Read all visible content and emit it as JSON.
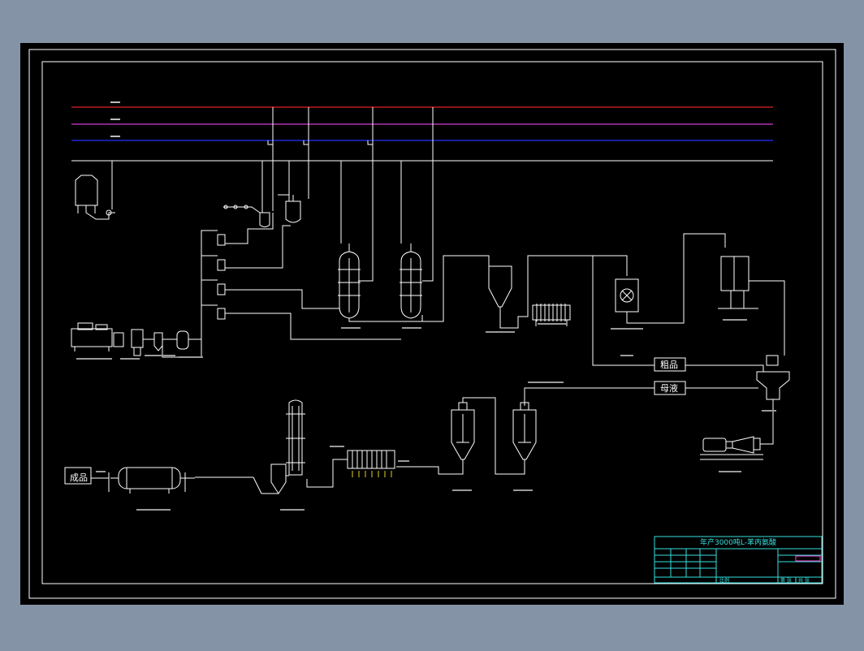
{
  "colors": {
    "app_background": "#8593a6",
    "drawing_background": "#000000",
    "line": "#ffffff",
    "utility_red": "#e0202a",
    "utility_magenta": "#d23cd2",
    "utility_blue": "#2233ff",
    "title_block": "#36e0e0",
    "title_block_accent": "#ff44cc",
    "title_block_label": "#e8e040"
  },
  "title_block": {
    "title": "年产3000吨L-苯丙氨酸",
    "scale_label": "比例",
    "sheet_label": "第 张",
    "total_label": "共 张"
  },
  "labels": {
    "final_product": "成品",
    "crude_product": "粗品",
    "mother_liquor": "母液"
  },
  "icons": [
    "storage-tank-icon",
    "fermenter-icon",
    "reactor-icon",
    "cyclone-icon",
    "filter-press-icon",
    "centrifuge-icon",
    "ion-exchange-column-icon",
    "crystallizer-icon",
    "pump-motor-icon",
    "rotary-dryer-icon",
    "evaporator-icon",
    "heat-exchanger-icon"
  ]
}
